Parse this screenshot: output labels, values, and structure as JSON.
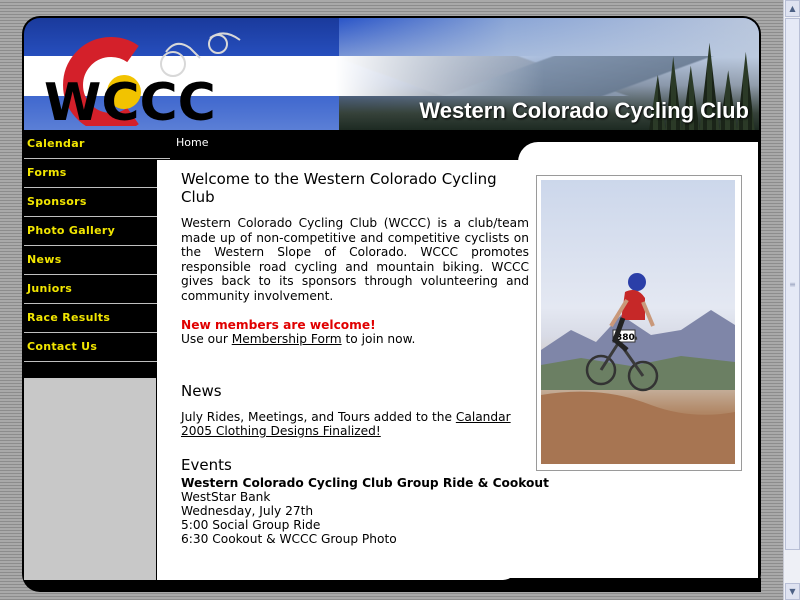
{
  "site": {
    "logo_text": "WCCC",
    "banner_title": "Western Colorado Cycling Club"
  },
  "nav": {
    "items": [
      {
        "label": "Calendar"
      },
      {
        "label": "Forms"
      },
      {
        "label": "Sponsors"
      },
      {
        "label": "Photo Gallery"
      },
      {
        "label": "News"
      },
      {
        "label": "Juniors"
      },
      {
        "label": "Race Results"
      },
      {
        "label": "Contact Us"
      }
    ]
  },
  "breadcrumb": "Home",
  "welcome": {
    "heading": "Welcome to the Western Colorado Cycling Club",
    "body": "Western Colorado Cycling Club (WCCC) is a club/team made up of non-competitive and competitive cyclists on the Western Slope of Colorado. WCCC promotes responsible road cycling and mountain biking. WCCC gives back to its sponsors through volunteering and community involvement.",
    "new_members": "New members are welcome!",
    "join_prefix": "Use our ",
    "join_link": "Membership Form",
    "join_suffix": " to join now."
  },
  "news": {
    "heading": "News",
    "line1_prefix": "July Rides, Meetings, and Tours added to the ",
    "line1_link": "Calandar",
    "line2_link": "2005 Clothing Designs Finalized!"
  },
  "events": {
    "heading": "Events",
    "title": "Western Colorado Cycling Club Group Ride & Cookout",
    "lines": [
      "WestStar Bank",
      "Wednesday, July 27th",
      "5:00 Social Group Ride",
      "6:30 Cookout & WCCC Group Photo"
    ]
  },
  "photo": {
    "bib_number": "380"
  },
  "colors": {
    "nav_text": "#f2e600",
    "accent_red": "#e00000",
    "flag_blue": "#1a3a9c",
    "flag_gold": "#f2c300"
  }
}
